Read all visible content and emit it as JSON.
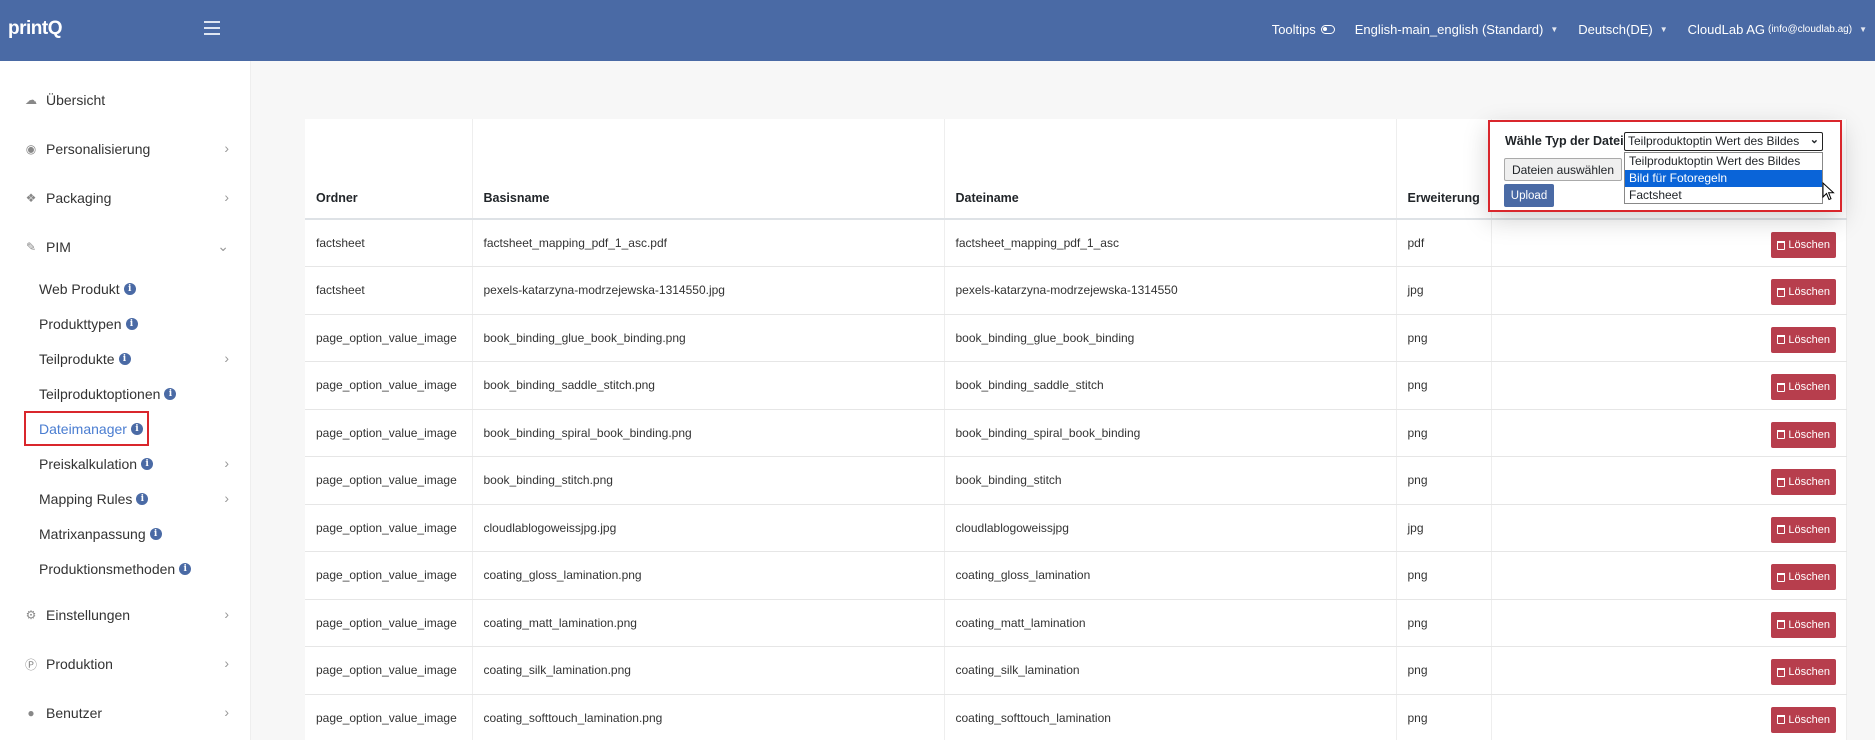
{
  "header": {
    "logo": "printQ",
    "tooltips_label": "Tooltips",
    "store_label": "English-main_english (Standard)",
    "language_label": "Deutsch(DE)",
    "account_name": "CloudLab AG",
    "account_email": "(info@cloudlab.ag)"
  },
  "sidebar": {
    "items": [
      {
        "label": "Übersicht",
        "icon": "cloud-icon"
      },
      {
        "label": "Personalisierung",
        "icon": "eye-icon"
      },
      {
        "label": "Packaging",
        "icon": "boxes-icon"
      },
      {
        "label": "PIM",
        "icon": "pencil-icon"
      },
      {
        "label": "Einstellungen",
        "icon": "gears-icon"
      },
      {
        "label": "Produktion",
        "icon": "p-circle-icon"
      },
      {
        "label": "Benutzer",
        "icon": "user-icon"
      }
    ],
    "pim_sub": [
      {
        "label": "Web Produkt"
      },
      {
        "label": "Produkttypen"
      },
      {
        "label": "Teilprodukte"
      },
      {
        "label": "Teilproduktoptionen"
      },
      {
        "label": "Dateimanager"
      },
      {
        "label": "Preiskalkulation"
      },
      {
        "label": "Mapping Rules"
      },
      {
        "label": "Matrixanpassung"
      },
      {
        "label": "Produktionsmethoden"
      }
    ]
  },
  "upload": {
    "type_label": "Wähle Typ der Datei",
    "selected": "Teilproduktoptin Wert des Bildes",
    "options": [
      "Teilproduktoptin Wert des Bildes",
      "Bild für Fotoregeln",
      "Factsheet"
    ],
    "choose_files": "Dateien auswählen",
    "upload_button": "Upload"
  },
  "table": {
    "headers": [
      "Ordner",
      "Basisname",
      "Dateiname",
      "Erweiterung"
    ],
    "delete_label": "Löschen",
    "rows": [
      [
        "factsheet",
        "factsheet_mapping_pdf_1_asc.pdf",
        "factsheet_mapping_pdf_1_asc",
        "pdf"
      ],
      [
        "factsheet",
        "pexels-katarzyna-modrzejewska-1314550.jpg",
        "pexels-katarzyna-modrzejewska-1314550",
        "jpg"
      ],
      [
        "page_option_value_image",
        "book_binding_glue_book_binding.png",
        "book_binding_glue_book_binding",
        "png"
      ],
      [
        "page_option_value_image",
        "book_binding_saddle_stitch.png",
        "book_binding_saddle_stitch",
        "png"
      ],
      [
        "page_option_value_image",
        "book_binding_spiral_book_binding.png",
        "book_binding_spiral_book_binding",
        "png"
      ],
      [
        "page_option_value_image",
        "book_binding_stitch.png",
        "book_binding_stitch",
        "png"
      ],
      [
        "page_option_value_image",
        "cloudlablogoweissjpg.jpg",
        "cloudlablogoweissjpg",
        "jpg"
      ],
      [
        "page_option_value_image",
        "coating_gloss_lamination.png",
        "coating_gloss_lamination",
        "png"
      ],
      [
        "page_option_value_image",
        "coating_matt_lamination.png",
        "coating_matt_lamination",
        "png"
      ],
      [
        "page_option_value_image",
        "coating_silk_lamination.png",
        "coating_silk_lamination",
        "png"
      ],
      [
        "page_option_value_image",
        "coating_softtouch_lamination.png",
        "coating_softtouch_lamination",
        "png"
      ]
    ]
  }
}
